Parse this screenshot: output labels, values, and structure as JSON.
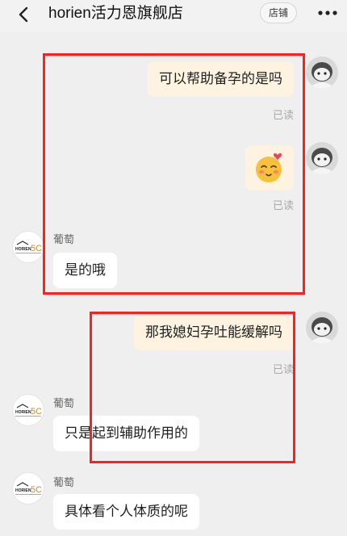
{
  "header": {
    "title": "horien活力恩旗舰店",
    "store_button": "店铺"
  },
  "messages": [
    {
      "side": "out",
      "text": "可以帮助备孕的是吗",
      "read": "已读"
    },
    {
      "side": "out",
      "emoji": "blushing-smile-emoji",
      "read": "已读"
    },
    {
      "side": "in",
      "sender": "葡萄",
      "text": "是的哦"
    },
    {
      "side": "out",
      "text": "那我媳妇孕吐能缓解吗",
      "read": "已读"
    },
    {
      "side": "in",
      "sender": "葡萄",
      "text": "只是起到辅助作用的"
    },
    {
      "side": "in",
      "sender": "葡萄",
      "text": "具体看个人体质的呢"
    }
  ],
  "shop_logo": {
    "brand": "HORIEN",
    "mark": "5C"
  },
  "colors": {
    "outgoing_bubble": "#fdf3e0",
    "incoming_bubble": "#ffffff",
    "annotation": "#ff1f1f",
    "background": "#efefef"
  }
}
